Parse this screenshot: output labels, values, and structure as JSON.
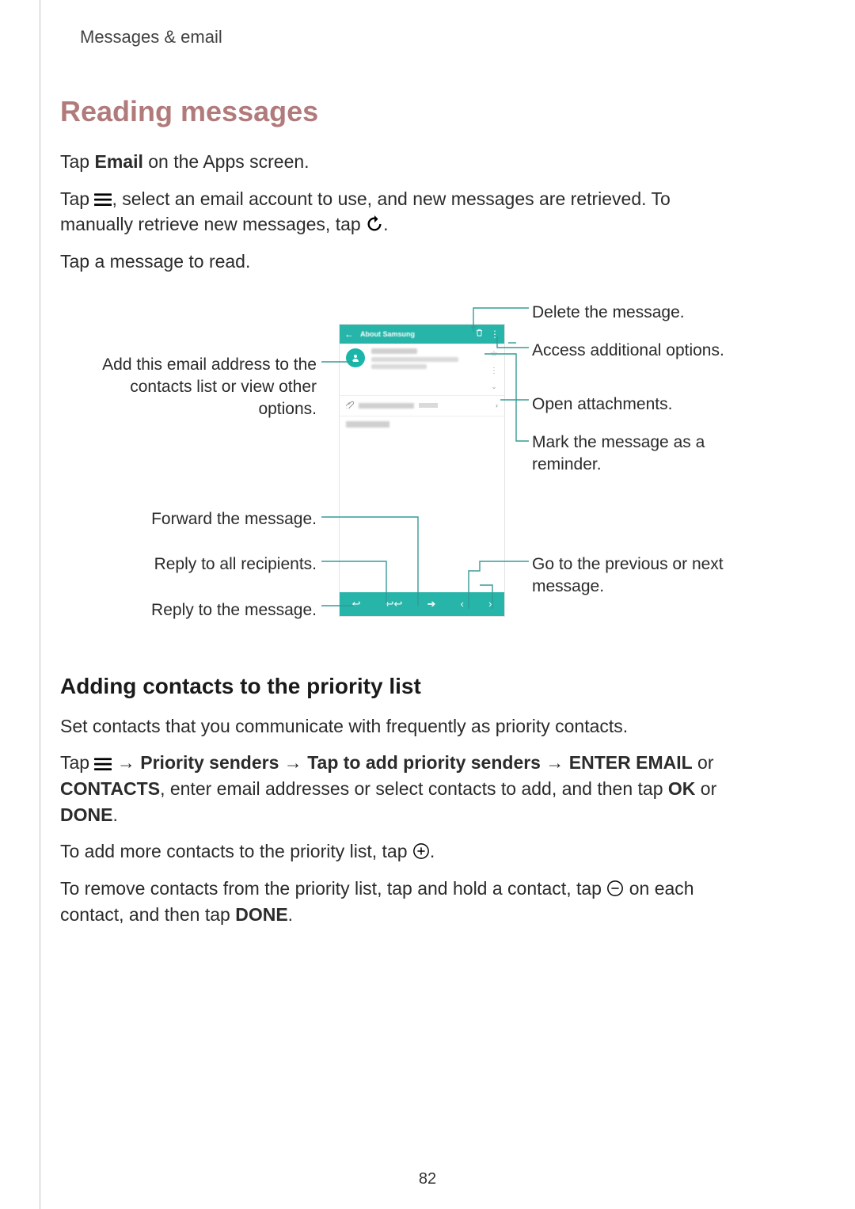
{
  "header": {
    "section": "Messages & email"
  },
  "title": "Reading messages",
  "para1": {
    "pre": "Tap ",
    "bold": "Email",
    "post": " on the Apps screen."
  },
  "para2": {
    "pre": "Tap ",
    "mid": ", select an email account to use, and new messages are retrieved. To manually retrieve new messages, tap ",
    "post": "."
  },
  "para3": "Tap a message to read.",
  "phone": {
    "headerTitle": "About Samsung"
  },
  "callouts": {
    "delete": "Delete the message.",
    "options": "Access additional options.",
    "attachments": "Open attachments.",
    "reminder": "Mark the message as a reminder.",
    "prevnext": "Go to the previous or next message.",
    "addcontact": "Add this email address to the contacts list or view other options.",
    "forward": "Forward the message.",
    "replyall": "Reply to all recipients.",
    "reply": "Reply to the message."
  },
  "subheading": "Adding contacts to the priority list",
  "para4": "Set contacts that you communicate with frequently as priority contacts.",
  "para5": {
    "t1": "Tap ",
    "arrow": " → ",
    "b1": "Priority senders",
    "b2": "Tap to add priority senders",
    "b3": "ENTER EMAIL",
    "or": " or ",
    "b4": "CONTACTS",
    "t2": ", enter email addresses or select contacts to add, and then tap ",
    "b5": "OK",
    "b6": "DONE",
    "period": "."
  },
  "para6": {
    "pre": "To add more contacts to the priority list, tap ",
    "post": "."
  },
  "para7": {
    "pre": "To remove contacts from the priority list, tap and hold a contact, tap ",
    "mid": " on each contact, and then tap ",
    "b": "DONE",
    "post": "."
  },
  "pageNumber": "82"
}
